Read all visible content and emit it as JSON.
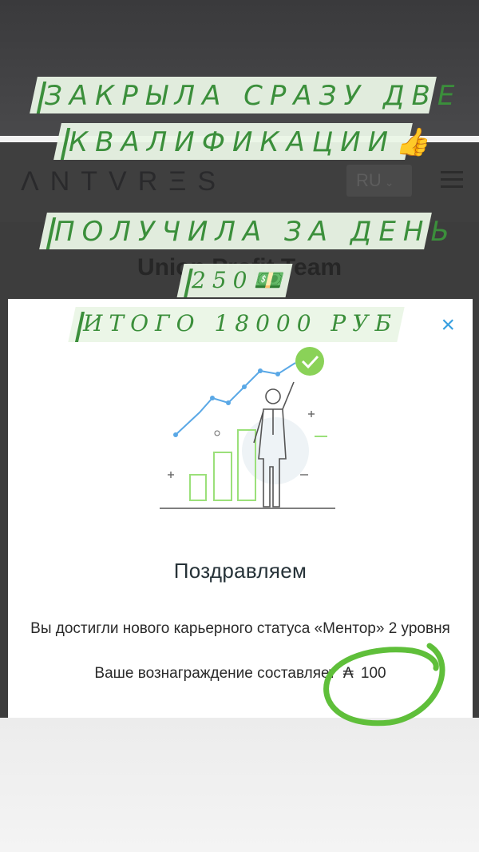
{
  "site": {
    "logo": "ΛNTVRΞS",
    "language": "RU",
    "language_chevron": "⌄",
    "page_title": "Union Profit Team"
  },
  "modal": {
    "close_label": "×",
    "heading": "Поздравляем",
    "description": "Вы достигли нового карьерного статуса «Ментор» 2 уровня",
    "reward_text": "Ваше вознаграждение составляет",
    "reward_currency": "₳",
    "reward_amount": "100"
  },
  "captions": {
    "line1": "ЗАКРЫЛА СРАЗУ ДВЕ",
    "line2": "КВАЛИФИКАЦИИ👍",
    "line3": "ПОЛУЧИЛА ЗА ДЕНЬ",
    "line4": "250💵",
    "line5": "ИТОГО 18000 РУБ"
  },
  "colors": {
    "accent_green": "#3b8f3b",
    "caption_bg": "#eaf5e6",
    "close_blue": "#39a0e0",
    "highlight_green": "#5fbf3a"
  }
}
